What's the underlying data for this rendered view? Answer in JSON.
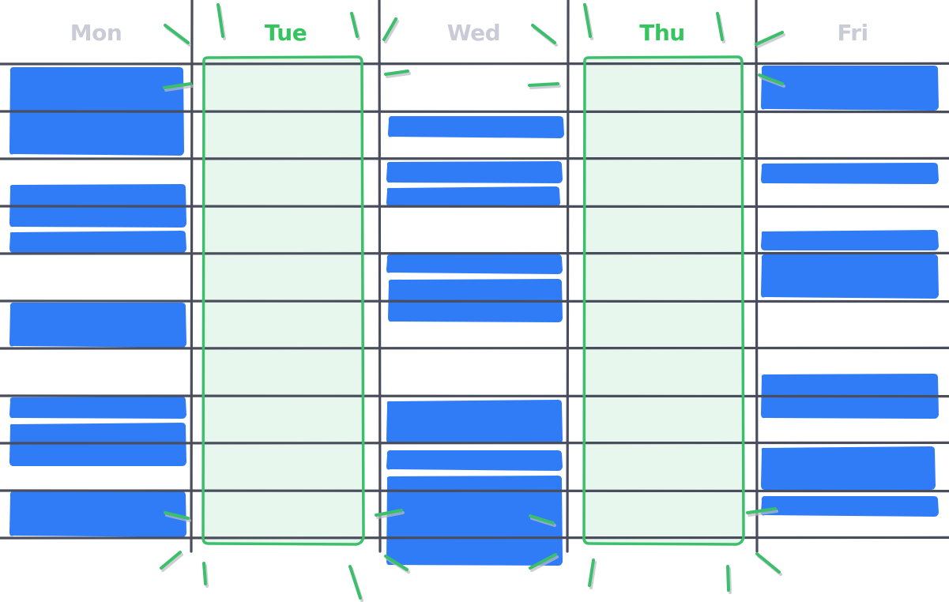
{
  "days": [
    {
      "name": "Mon",
      "highlighted": false
    },
    {
      "name": "Tue",
      "highlighted": true
    },
    {
      "name": "Wed",
      "highlighted": false
    },
    {
      "name": "Thu",
      "highlighted": true
    },
    {
      "name": "Fri",
      "highlighted": false
    }
  ],
  "colors": {
    "grid_line": "#4a4d5c",
    "busy_block": "#2f7cf6",
    "highlight_border": "#3cbf6b",
    "highlight_fill": "#e8f7ee",
    "label_muted": "#c9ccd6",
    "label_active": "#36c45f",
    "spark": "#3cbf6b",
    "spark_shadow": "#b9bcc6"
  },
  "meaning": {
    "busy_block": "busy",
    "highlighted_column": "free day"
  }
}
